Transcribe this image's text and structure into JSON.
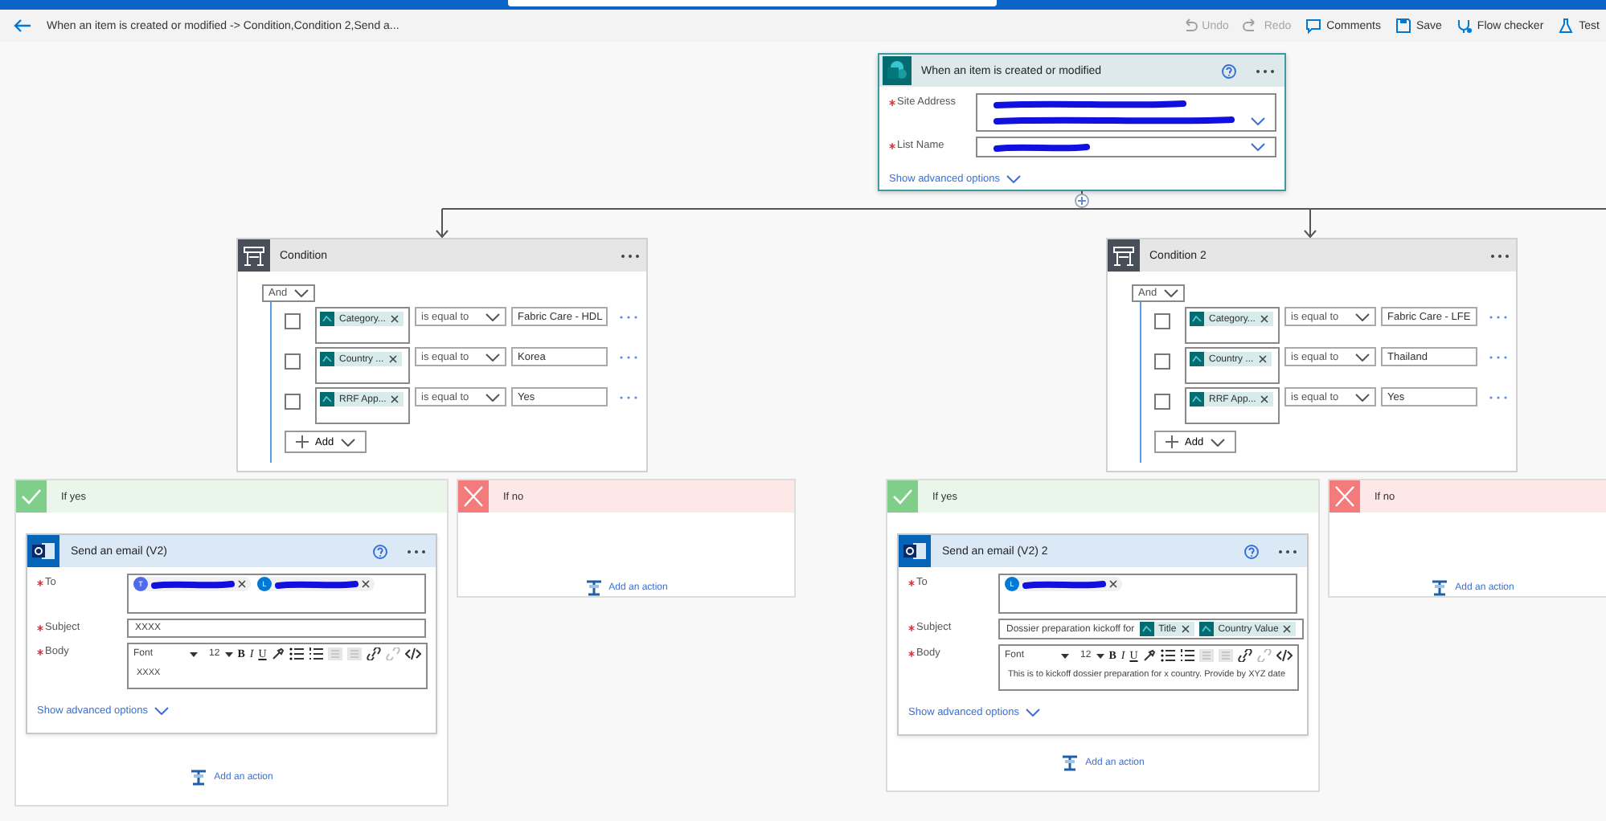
{
  "command_bar": {
    "title": "When an item is created or modified -> Condition,Condition 2,Send a...",
    "actions": [
      {
        "kind": "undo",
        "label": "Undo",
        "disabled": true
      },
      {
        "kind": "redo",
        "label": "Redo",
        "disabled": true
      },
      {
        "kind": "comments",
        "label": "Comments",
        "disabled": false
      },
      {
        "kind": "save",
        "label": "Save",
        "disabled": false
      },
      {
        "kind": "checker",
        "label": "Flow checker",
        "disabled": false
      },
      {
        "kind": "test",
        "label": "Test",
        "disabled": false
      }
    ]
  },
  "trigger": {
    "title": "When an item is created or modified",
    "fields": [
      {
        "kind": "multiline",
        "label": "Site Address",
        "required": true
      },
      {
        "kind": "single",
        "label": "List Name",
        "required": true
      }
    ],
    "advanced_link": "Show advanced options"
  },
  "conditions": [
    {
      "title": "Condition",
      "group_operator": "And",
      "rows": [
        {
          "checked": false,
          "token": "Category...",
          "operator": "is equal to",
          "value": "Fabric Care - HDL"
        },
        {
          "checked": false,
          "token": "Country ...",
          "operator": "is equal to",
          "value": "Korea"
        },
        {
          "checked": false,
          "token": "RRF App...",
          "operator": "is equal to",
          "value": "Yes"
        }
      ],
      "add_label": "Add",
      "if_yes": {
        "title": "If yes",
        "action": {
          "title": "Send an email (V2)",
          "to_label": "To",
          "required": true,
          "recipients": [
            {
              "initial": "T",
              "color": "#4f6bed"
            },
            {
              "initial": "L",
              "color": "#0078d4"
            }
          ],
          "subject_label": "Subject",
          "subject": [
            {
              "kind": "text",
              "text": "XXXX"
            }
          ],
          "body_label": "Body",
          "toolbar": {
            "font": "Font",
            "size": "12",
            "buttons": [
              "B",
              "I",
              "U"
            ]
          },
          "body": "XXXX",
          "advanced_link": "Show advanced options"
        },
        "add_action": "Add an action"
      },
      "if_no": {
        "title": "If no",
        "add_action": "Add an action"
      }
    },
    {
      "title": "Condition 2",
      "group_operator": "And",
      "rows": [
        {
          "checked": false,
          "token": "Category...",
          "operator": "is equal to",
          "value": "Fabric Care - LFE"
        },
        {
          "checked": false,
          "token": "Country ...",
          "operator": "is equal to",
          "value": "Thailand"
        },
        {
          "checked": false,
          "token": "RRF App...",
          "operator": "is equal to",
          "value": "Yes"
        }
      ],
      "add_label": "Add",
      "if_yes": {
        "title": "If yes",
        "action": {
          "title": "Send an email (V2) 2",
          "to_label": "To",
          "required": true,
          "recipients": [
            {
              "initial": "L",
              "color": "#0078d4"
            }
          ],
          "subject_label": "Subject",
          "subject": [
            {
              "kind": "text",
              "text": "Dossier preparation kickoff for"
            },
            {
              "kind": "token",
              "text": "Title"
            },
            {
              "kind": "token",
              "text": "Country Value"
            }
          ],
          "body_label": "Body",
          "toolbar": {
            "font": "Font",
            "size": "12",
            "buttons": [
              "B",
              "I",
              "U"
            ]
          },
          "body": "This is to kickoff dossier preparation for x country. Provide by XYZ date",
          "advanced_link": "Show advanced options"
        },
        "add_action": "Add an action"
      },
      "if_no": {
        "title": "If no",
        "add_action": "Add an action"
      }
    }
  ]
}
